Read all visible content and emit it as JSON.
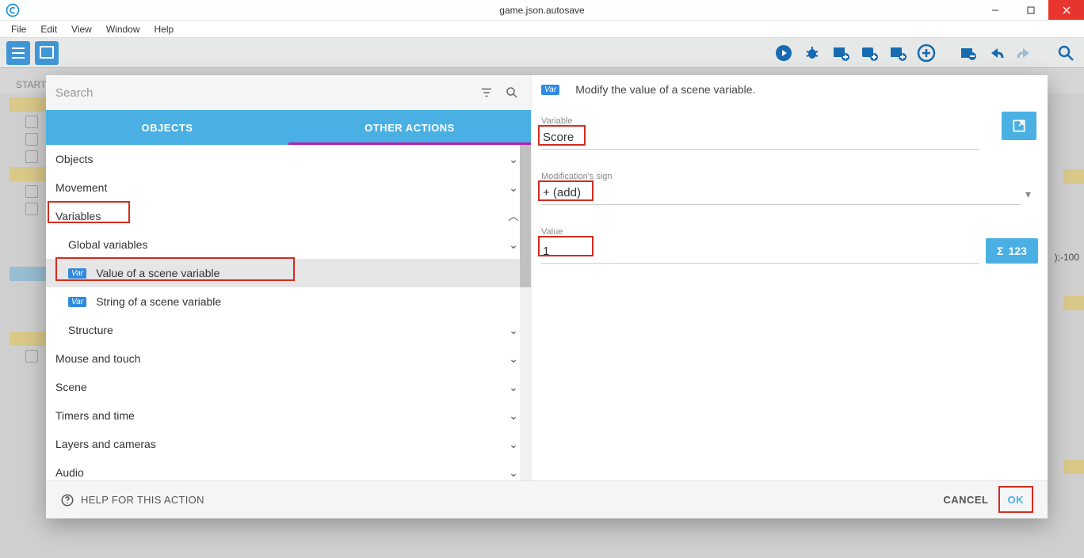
{
  "window": {
    "title": "game.json.autosave"
  },
  "menubar": [
    "File",
    "Edit",
    "View",
    "Window",
    "Help"
  ],
  "bg": {
    "tab": "START",
    "right_snippet": ");-100"
  },
  "dialog": {
    "search_placeholder": "Search",
    "tabs": {
      "objects": "OBJECTS",
      "other": "OTHER ACTIONS"
    },
    "tree": {
      "objects": "Objects",
      "movement": "Movement",
      "variables": "Variables",
      "global_variables": "Global variables",
      "value_scene_var": "Value of a scene variable",
      "string_scene_var": "String of a scene variable",
      "structure": "Structure",
      "mouse_touch": "Mouse and touch",
      "scene": "Scene",
      "timers": "Timers and time",
      "layers": "Layers and cameras",
      "audio": "Audio"
    },
    "right": {
      "header": "Modify the value of a scene variable.",
      "variable_label": "Variable",
      "variable_value": "Score",
      "sign_label": "Modification's sign",
      "sign_value": "+ (add)",
      "value_label": "Value",
      "value_value": "1",
      "sigma": "123"
    },
    "footer": {
      "help": "HELP FOR THIS ACTION",
      "cancel": "CANCEL",
      "ok": "OK"
    }
  }
}
